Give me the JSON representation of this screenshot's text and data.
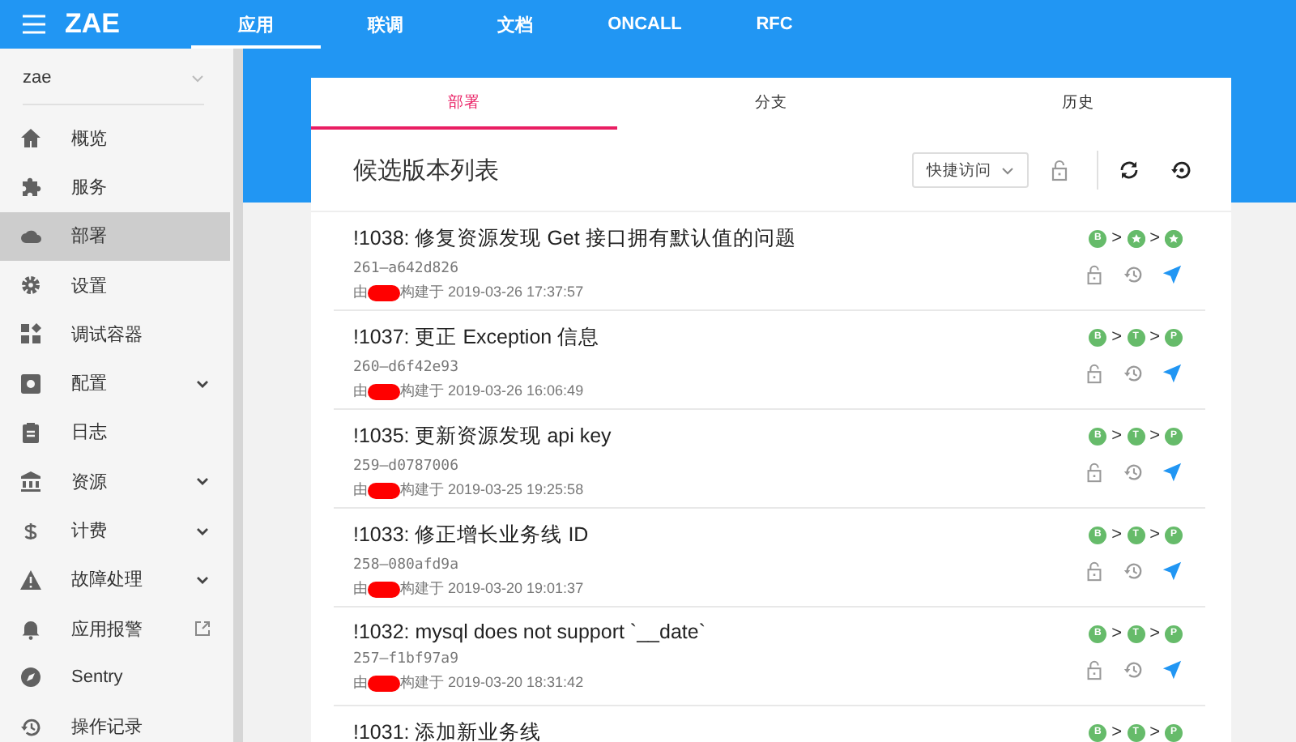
{
  "app_bar": {
    "title": "ZAE",
    "tabs": [
      {
        "label": "应用",
        "selected": true
      },
      {
        "label": "联调",
        "selected": false
      },
      {
        "label": "文档",
        "selected": false
      },
      {
        "label": "ONCALL",
        "selected": false
      },
      {
        "label": "RFC",
        "selected": false
      }
    ]
  },
  "sidebar": {
    "app_select": "zae",
    "items": [
      {
        "label": "概览",
        "selected": false
      },
      {
        "label": "服务",
        "selected": false
      },
      {
        "label": "部署",
        "selected": true
      },
      {
        "label": "设置",
        "selected": false
      },
      {
        "label": "调试容器",
        "selected": false
      },
      {
        "label": "配置",
        "selected": false,
        "expandable": true
      },
      {
        "label": "日志",
        "selected": false
      },
      {
        "label": "资源",
        "selected": false,
        "expandable": true
      },
      {
        "label": "计费",
        "selected": false,
        "expandable": true
      },
      {
        "label": "故障处理",
        "selected": false,
        "expandable": true
      },
      {
        "label": "应用报警",
        "selected": false,
        "external_link": true
      },
      {
        "label": "Sentry",
        "selected": false
      },
      {
        "label": "操作记录",
        "selected": false
      }
    ]
  },
  "card": {
    "tabs": [
      {
        "label": "部署",
        "selected": true
      },
      {
        "label": "分支",
        "selected": false
      },
      {
        "label": "历史",
        "selected": false
      }
    ],
    "title": "候选版本列表",
    "quick_access": "快捷访问",
    "rows": [
      {
        "title": "!1038: 修复资源发现 Get 接口拥有默认值的问题",
        "hash": "261–a642d826",
        "by": "由",
        "built": "构建于 2019-03-26 17:37:57",
        "redacted": true,
        "stages": [
          {
            "kind": "letter",
            "label": "B"
          },
          {
            "kind": "star",
            "separator": ">"
          },
          {
            "kind": "star",
            "separator": ">"
          }
        ]
      },
      {
        "title": "!1037: 更正 Exception 信息",
        "hash": "260–d6f42e93",
        "by": "由",
        "built": "构建于 2019-03-26 16:06:49",
        "redacted": true,
        "stages": [
          {
            "kind": "letter",
            "label": "B"
          },
          {
            "kind": "letter",
            "label": "T",
            "separator": ">"
          },
          {
            "kind": "letter",
            "label": "P",
            "separator": ">"
          }
        ]
      },
      {
        "title": "!1035: 更新资源发现 api key",
        "hash": "259–d0787006",
        "by": "由",
        "built": "构建于 2019-03-25 19:25:58",
        "redacted": true,
        "stages": [
          {
            "kind": "letter",
            "label": "B"
          },
          {
            "kind": "letter",
            "label": "T",
            "separator": ">"
          },
          {
            "kind": "letter",
            "label": "P",
            "separator": ">"
          }
        ]
      },
      {
        "title": "!1033: 修正增长业务线 ID",
        "hash": "258–080afd9a",
        "by": "由",
        "built": "构建于 2019-03-20 19:01:37",
        "redacted": true,
        "stages": [
          {
            "kind": "letter",
            "label": "B"
          },
          {
            "kind": "letter",
            "label": "T",
            "separator": ">"
          },
          {
            "kind": "letter",
            "label": "P",
            "separator": ">"
          }
        ]
      },
      {
        "title": "!1032: mysql does not support `__date`",
        "hash": "257–f1bf97a9",
        "by": "由",
        "built": "构建于 2019-03-20 18:31:42",
        "redacted": true,
        "stages": [
          {
            "kind": "letter",
            "label": "B"
          },
          {
            "kind": "letter",
            "label": "T",
            "separator": ">"
          },
          {
            "kind": "letter",
            "label": "P",
            "separator": ">"
          }
        ]
      },
      {
        "title": "!1031: 添加新业务线",
        "stages": [
          {
            "kind": "letter",
            "label": "B"
          },
          {
            "kind": "letter",
            "label": "T",
            "separator": ">"
          },
          {
            "kind": "letter",
            "label": "P",
            "separator": ">"
          }
        ]
      }
    ]
  }
}
